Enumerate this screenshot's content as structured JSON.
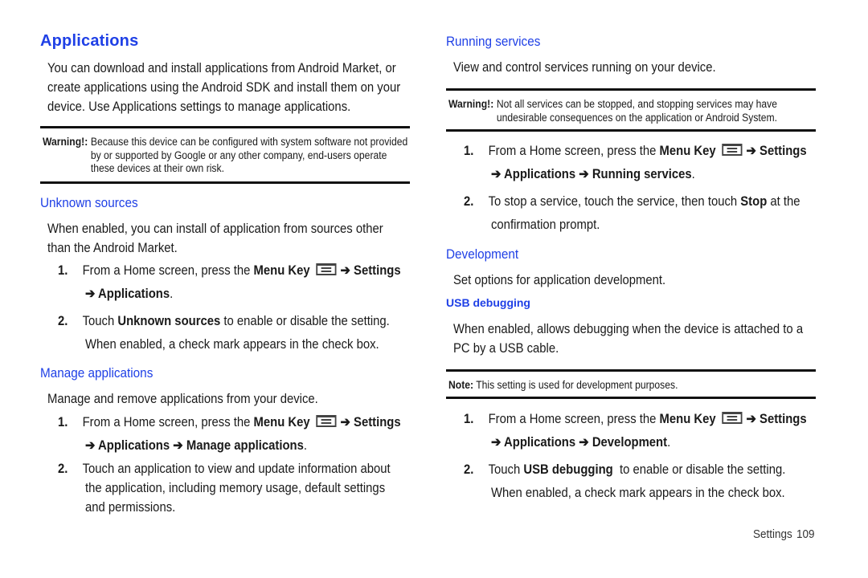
{
  "left": {
    "title": "Applications",
    "intro": "You can download and install applications from Android Market, or create applications using the Android SDK and install them on your device. Use Applications settings to manage applications.",
    "warning_label": "Warning!:",
    "warning_text": "Because this device can be configured with system software not provided by or supported by Google or any other company, end-users operate these devices at their own risk.",
    "unknown": {
      "heading": "Unknown sources",
      "desc": "When enabled, you can install of application from sources other than the Android Market.",
      "step1_num": "1.",
      "step1_pre": "From a Home screen, press the ",
      "step1_key": "Menu Key",
      "step1_settings": "➔ Settings",
      "step1_line2": "➔ Applications",
      "step2_num": "2.",
      "step2_pre": "Touch ",
      "step2_bold": "Unknown sources",
      "step2_post": " to enable or disable the setting.",
      "step2_line2": "When enabled, a check mark appears in the check box."
    },
    "manage": {
      "heading": "Manage applications",
      "desc": "Manage and remove applications from your device.",
      "step1_num": "1.",
      "step1_pre": "From a Home screen, press the ",
      "step1_key": "Menu Key",
      "step1_settings": "➔ Settings",
      "step1_line2": "➔ Applications ➔ Manage applications",
      "step2_num": "2.",
      "step2_line1": "Touch an application to view and update information about",
      "step2_line2": "the application, including memory usage, default settings",
      "step2_line3": "and permissions."
    }
  },
  "right": {
    "running": {
      "heading": "Running services",
      "desc": "View and control services running on your device.",
      "warning_label": "Warning!:",
      "warning_text": "Not all services can be stopped, and stopping services may have undesirable consequences on the application or Android System.",
      "step1_num": "1.",
      "step1_pre": "From a Home screen, press the ",
      "step1_key": "Menu Key",
      "step1_settings": "➔ Settings",
      "step1_line2": "➔ Applications ➔ Running services",
      "step2_num": "2.",
      "step2_pre": "To stop a service, touch the service, then touch ",
      "step2_bold": "Stop",
      "step2_post": " at the",
      "step2_line2": "confirmation prompt."
    },
    "development": {
      "heading": "Development",
      "desc": "Set options for application development.",
      "usb_heading": "USB debugging",
      "usb_desc": "When enabled, allows debugging when the device is attached to a PC by a USB cable.",
      "note_label": "Note:",
      "note_text": "This setting is used for development purposes.",
      "step1_num": "1.",
      "step1_pre": "From a Home screen, press the ",
      "step1_key": "Menu Key",
      "step1_settings": "➔ Settings",
      "step1_line2": "➔ Applications ➔ Development",
      "step2_num": "2.",
      "step2_pre": "Touch ",
      "step2_bold": "USB debugging",
      "step2_post": "  to enable or disable the setting.",
      "step2_line2": "When enabled, a check mark appears in the check box."
    }
  },
  "footer": {
    "section": "Settings",
    "page": "109"
  }
}
